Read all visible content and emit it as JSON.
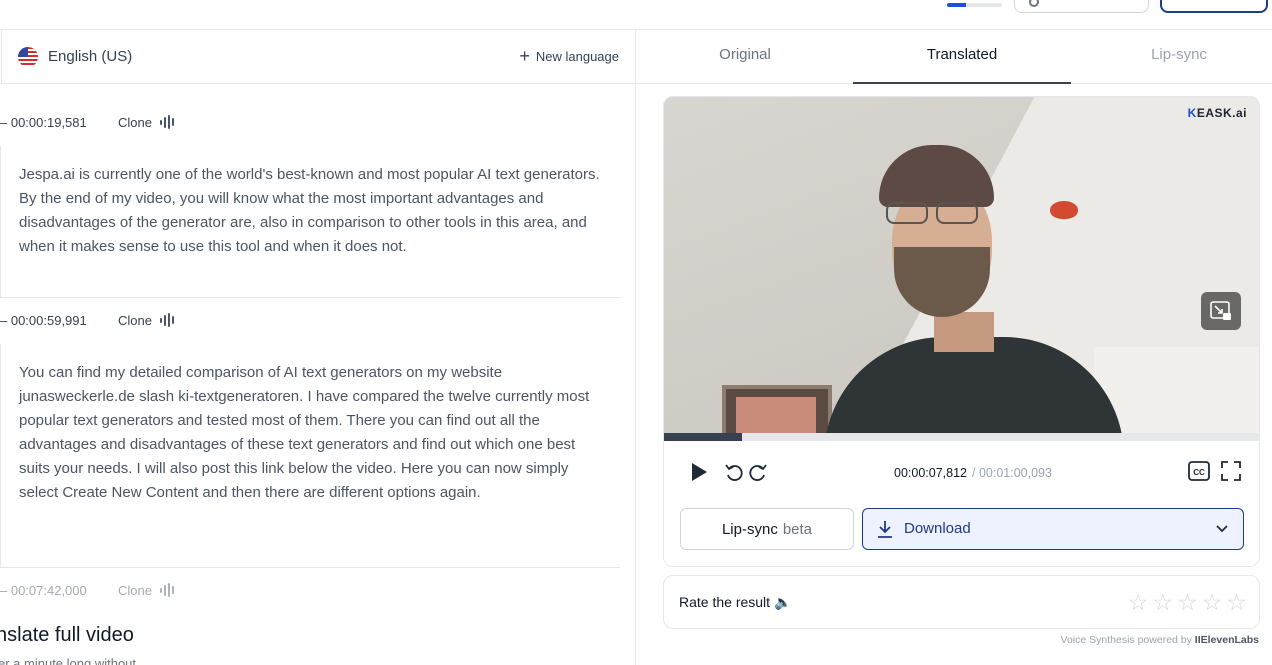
{
  "topbar": {
    "progress_fraction": 0.35,
    "accent": "#1d4ed8"
  },
  "language_bar": {
    "language": "English (US)",
    "new_language_label": "New language"
  },
  "segments": [
    {
      "time": "– 00:00:19,581",
      "clone_label": "Clone",
      "text": "Jespa.ai is currently one of the world's best-known and most popular AI text generators. By the end of my video, you will know what the most important advantages and disadvantages of the generator are, also in comparison to other tools in this area, and when it makes sense to use this tool and when it does not."
    },
    {
      "time": "– 00:00:59,991",
      "clone_label": "Clone",
      "text": "You can find my detailed comparison of AI text generators on my website junasweckerle.de slash ki-textgeneratoren. I have compared the twelve currently most popular text generators and tested most of them. There you can find out all the advantages and disadvantages of these text generators and find out which one best suits your needs. I will also post this link below the video. Here you can now simply select Create New Content and then there are different options again."
    },
    {
      "time": "– 00:07:42,000",
      "clone_label": "Clone"
    }
  ],
  "translate_card": {
    "title": "nslate full video",
    "subtitle": "er a minute long without"
  },
  "tabs": [
    {
      "label": "Original"
    },
    {
      "label": "Translated"
    },
    {
      "label": "Lip-sync"
    }
  ],
  "player": {
    "watermark": "EASK.ai",
    "current_time": "00:00:07,812",
    "total_time": "/ 00:01:00,093",
    "progress_fraction": 0.13
  },
  "actions": {
    "lipsync_label": "Lip-sync",
    "lipsync_badge": "beta",
    "download_label": "Download"
  },
  "rating": {
    "label": "Rate the result 🔈",
    "stars": 5,
    "value": 0
  },
  "footer": {
    "powered_prefix": "Voice Synthesis powered by",
    "powered_brand": "IIElevenLabs"
  }
}
